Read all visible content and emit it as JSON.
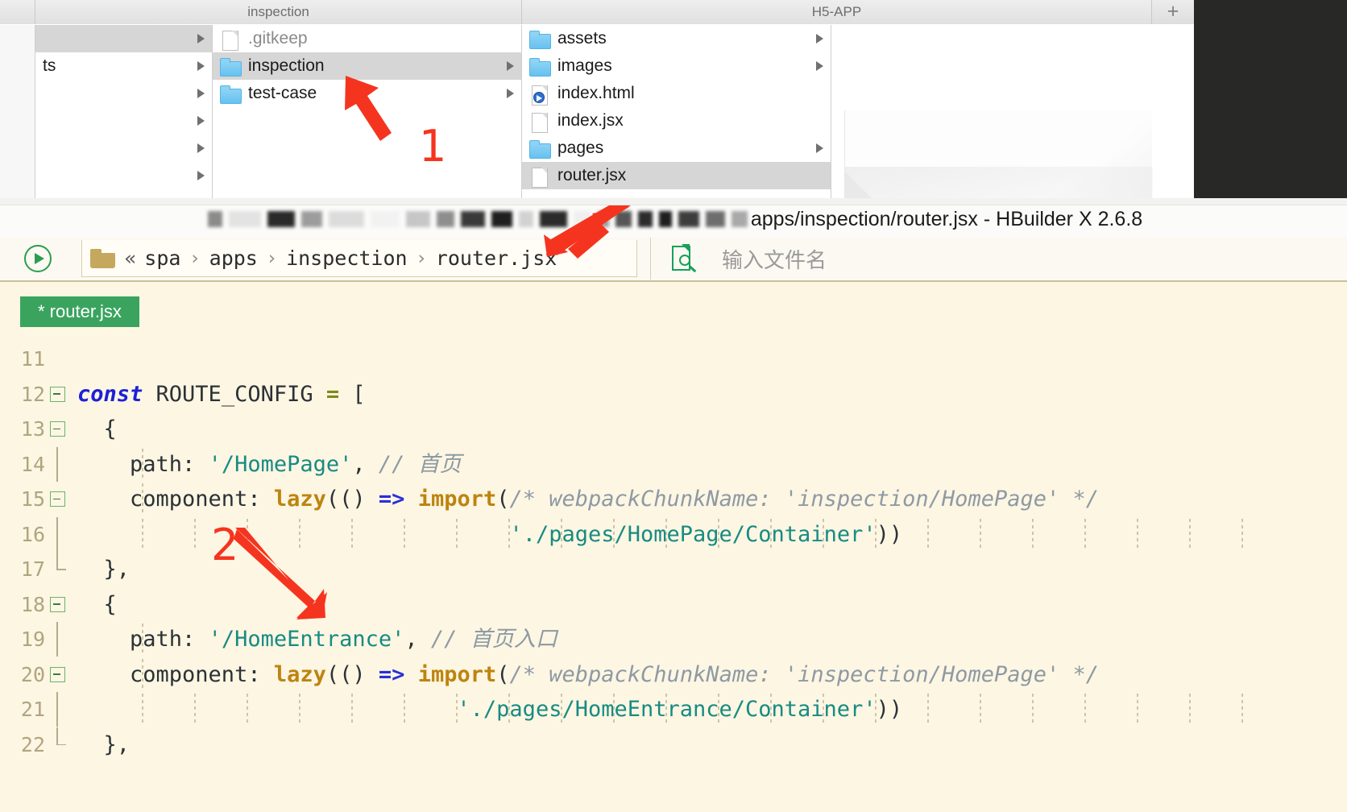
{
  "finder": {
    "tabs": [
      {
        "label": "",
        "width": "w1"
      },
      {
        "label": "inspection",
        "width": "w2"
      },
      {
        "label": "H5-APP",
        "width": "w3"
      }
    ],
    "new_tab_label": "+",
    "column_middle": [
      {
        "label": "",
        "kind": "blank",
        "chevron": true,
        "selected": true
      },
      {
        "label": "ts",
        "kind": "clipped-text",
        "chevron": true,
        "selected": false
      },
      {
        "label": "",
        "kind": "blank",
        "chevron": true,
        "selected": false
      },
      {
        "label": "",
        "kind": "blank",
        "chevron": true,
        "selected": false
      },
      {
        "label": "",
        "kind": "blank",
        "chevron": true,
        "selected": false
      },
      {
        "label": "",
        "kind": "blank",
        "chevron": true,
        "selected": false
      }
    ],
    "column_inspection": [
      {
        "label": ".gitkeep",
        "kind": "file",
        "chevron": false,
        "selected": false
      },
      {
        "label": "inspection",
        "kind": "folder",
        "chevron": true,
        "selected": true
      },
      {
        "label": "test-case",
        "kind": "folder",
        "chevron": true,
        "selected": false
      }
    ],
    "column_h5app": [
      {
        "label": "assets",
        "kind": "folder",
        "chevron": true,
        "selected": false
      },
      {
        "label": "images",
        "kind": "folder",
        "chevron": true,
        "selected": false
      },
      {
        "label": "index.html",
        "kind": "file-html",
        "chevron": false,
        "selected": false
      },
      {
        "label": "index.jsx",
        "kind": "file",
        "chevron": false,
        "selected": false
      },
      {
        "label": "pages",
        "kind": "folder",
        "chevron": true,
        "selected": false
      },
      {
        "label": "router.jsx",
        "kind": "file",
        "chevron": false,
        "selected": true
      }
    ]
  },
  "window": {
    "title_visible": "apps/inspection/router.jsx - HBuilder X 2.6.8"
  },
  "toolbar": {
    "run_icon": "run-icon",
    "breadcrumb": {
      "root_glyph": "«",
      "items": [
        "spa",
        "apps",
        "inspection",
        "router.jsx"
      ],
      "separator": "›"
    },
    "search_placeholder": "输入文件名"
  },
  "editor": {
    "tab_label": "* router.jsx",
    "lines": [
      {
        "num": "11",
        "fold": "none",
        "guides": [],
        "segments": []
      },
      {
        "num": "12",
        "fold": "box",
        "guides": [],
        "segments": [
          {
            "t": "const",
            "c": "k-const"
          },
          {
            "t": " ROUTE_CONFIG ",
            "c": "k-plain"
          },
          {
            "t": "=",
            "c": "k-op"
          },
          {
            "t": " [",
            "c": "k-brk"
          }
        ]
      },
      {
        "num": "13",
        "fold": "box",
        "guides": [],
        "segments": [
          {
            "t": "  {",
            "c": "k-brk"
          }
        ]
      },
      {
        "num": "14",
        "fold": "bar",
        "guides": [
          80
        ],
        "segments": [
          {
            "t": "    path: ",
            "c": "k-plain"
          },
          {
            "t": "'/HomePage'",
            "c": "k-str"
          },
          {
            "t": ", ",
            "c": "k-plain"
          },
          {
            "t": "// 首页",
            "c": "k-cmt"
          }
        ]
      },
      {
        "num": "15",
        "fold": "box",
        "guides": [
          80
        ],
        "segments": [
          {
            "t": "    component: ",
            "c": "k-plain"
          },
          {
            "t": "lazy",
            "c": "k-fn"
          },
          {
            "t": "(() ",
            "c": "k-brk"
          },
          {
            "t": "=>",
            "c": "k-arrow"
          },
          {
            "t": " ",
            "c": "k-plain"
          },
          {
            "t": "import",
            "c": "k-fn"
          },
          {
            "t": "(",
            "c": "k-brk"
          },
          {
            "t": "/* webpackChunkName: 'inspection/HomePage' */",
            "c": "k-cmt"
          }
        ]
      },
      {
        "num": "16",
        "fold": "bar",
        "guides": [
          80,
          145,
          210,
          275,
          340,
          405,
          470,
          535,
          600,
          665,
          730,
          795,
          860,
          925,
          990,
          1055,
          1120,
          1185,
          1250,
          1315,
          1380,
          1445
        ],
        "segments": [
          {
            "t": "                                 ",
            "c": "k-plain"
          },
          {
            "t": "'./pages/HomePage/Container'",
            "c": "k-str"
          },
          {
            "t": "))",
            "c": "k-brk"
          }
        ]
      },
      {
        "num": "17",
        "fold": "endbar",
        "guides": [],
        "segments": [
          {
            "t": "  },",
            "c": "k-brk"
          }
        ]
      },
      {
        "num": "18",
        "fold": "box",
        "guides": [],
        "segments": [
          {
            "t": "  {",
            "c": "k-brk"
          }
        ]
      },
      {
        "num": "19",
        "fold": "bar",
        "guides": [
          80
        ],
        "segments": [
          {
            "t": "    path: ",
            "c": "k-plain"
          },
          {
            "t": "'/HomeEntrance'",
            "c": "k-str"
          },
          {
            "t": ", ",
            "c": "k-plain"
          },
          {
            "t": "// 首页入口",
            "c": "k-cmt"
          }
        ]
      },
      {
        "num": "20",
        "fold": "box",
        "guides": [
          80
        ],
        "segments": [
          {
            "t": "    component: ",
            "c": "k-plain"
          },
          {
            "t": "lazy",
            "c": "k-fn"
          },
          {
            "t": "(() ",
            "c": "k-brk"
          },
          {
            "t": "=>",
            "c": "k-arrow"
          },
          {
            "t": " ",
            "c": "k-plain"
          },
          {
            "t": "import",
            "c": "k-fn"
          },
          {
            "t": "(",
            "c": "k-brk"
          },
          {
            "t": "/* webpackChunkName: 'inspection/HomePage' */",
            "c": "k-cmt"
          }
        ]
      },
      {
        "num": "21",
        "fold": "bar",
        "guides": [
          80,
          145,
          210,
          275,
          340,
          405,
          470,
          535,
          600,
          665,
          730,
          795,
          860,
          925,
          990,
          1055,
          1120,
          1185,
          1250,
          1315,
          1380,
          1445
        ],
        "segments": [
          {
            "t": "                             ",
            "c": "k-plain"
          },
          {
            "t": "'./pages/HomeEntrance/Container'",
            "c": "k-str"
          },
          {
            "t": "))",
            "c": "k-brk"
          }
        ]
      },
      {
        "num": "22",
        "fold": "endbar",
        "guides": [],
        "segments": [
          {
            "t": "  },",
            "c": "k-brk"
          }
        ]
      }
    ]
  },
  "annotations": [
    {
      "label": "1"
    },
    {
      "label": "2"
    }
  ],
  "colors": {
    "accent_green": "#3aa45f",
    "annotation_red": "#f5341f",
    "editor_bg": "#fdf6e3",
    "folder_blue": "#66c2f0",
    "string_teal": "#178b82",
    "keyword_blue": "#1c20d6",
    "comment_gray": "#8e9aa3",
    "function_gold": "#bd8410"
  }
}
